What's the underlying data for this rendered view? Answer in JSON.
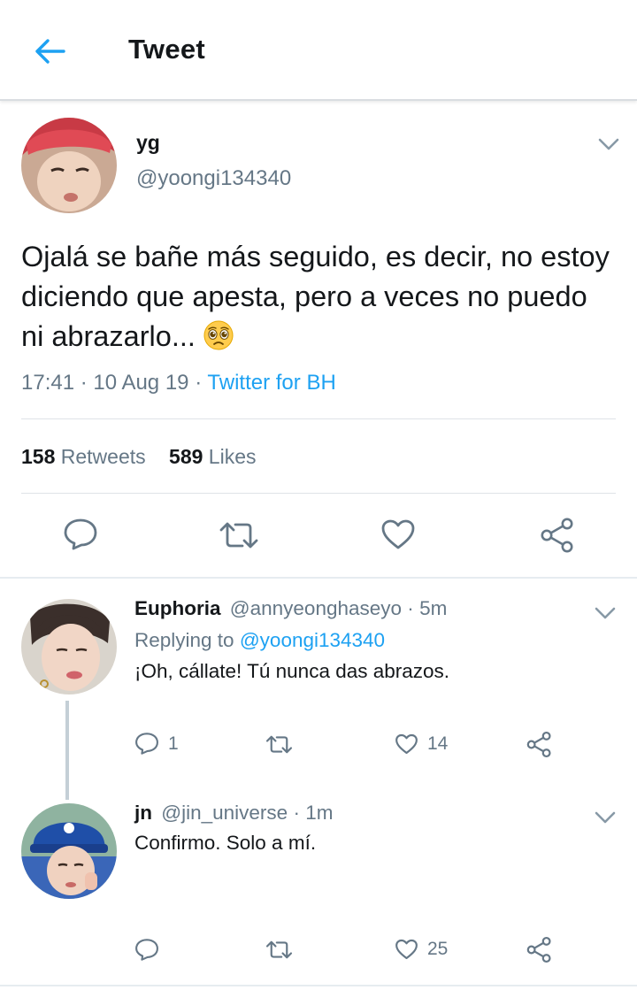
{
  "header": {
    "title": "Tweet"
  },
  "tweet": {
    "name": "yg",
    "handle": "@yoongi134340",
    "text": "Ojalá se bañe más seguido, es decir, no estoy diciendo que apesta, pero a veces no puedo ni abrazarlo...",
    "emoji_icon": "crying-face-emoji-icon",
    "time": "17:41",
    "date": "10 Aug 19",
    "source": "Twitter for BH",
    "retweets_count": "158",
    "retweets_label": "Retweets",
    "likes_count": "589",
    "likes_label": "Likes"
  },
  "replies": [
    {
      "name": "Euphoria",
      "handle": "@annyeonghaseyo",
      "time": "5m",
      "replying_prefix": "Replying to",
      "replying_handle": "@yoongi134340",
      "text": "¡Oh, cállate! Tú nunca das abrazos.",
      "reply_count": "1",
      "retweet_count": "",
      "like_count": "14"
    },
    {
      "name": "jn",
      "handle": "@jin_universe",
      "time": "1m",
      "text": "Confirmo. Solo a mí.",
      "reply_count": "",
      "retweet_count": "",
      "like_count": "25"
    }
  ],
  "separator": "·",
  "colors": {
    "accent": "#1da1f2",
    "muted": "#657786",
    "text": "#14171a"
  }
}
